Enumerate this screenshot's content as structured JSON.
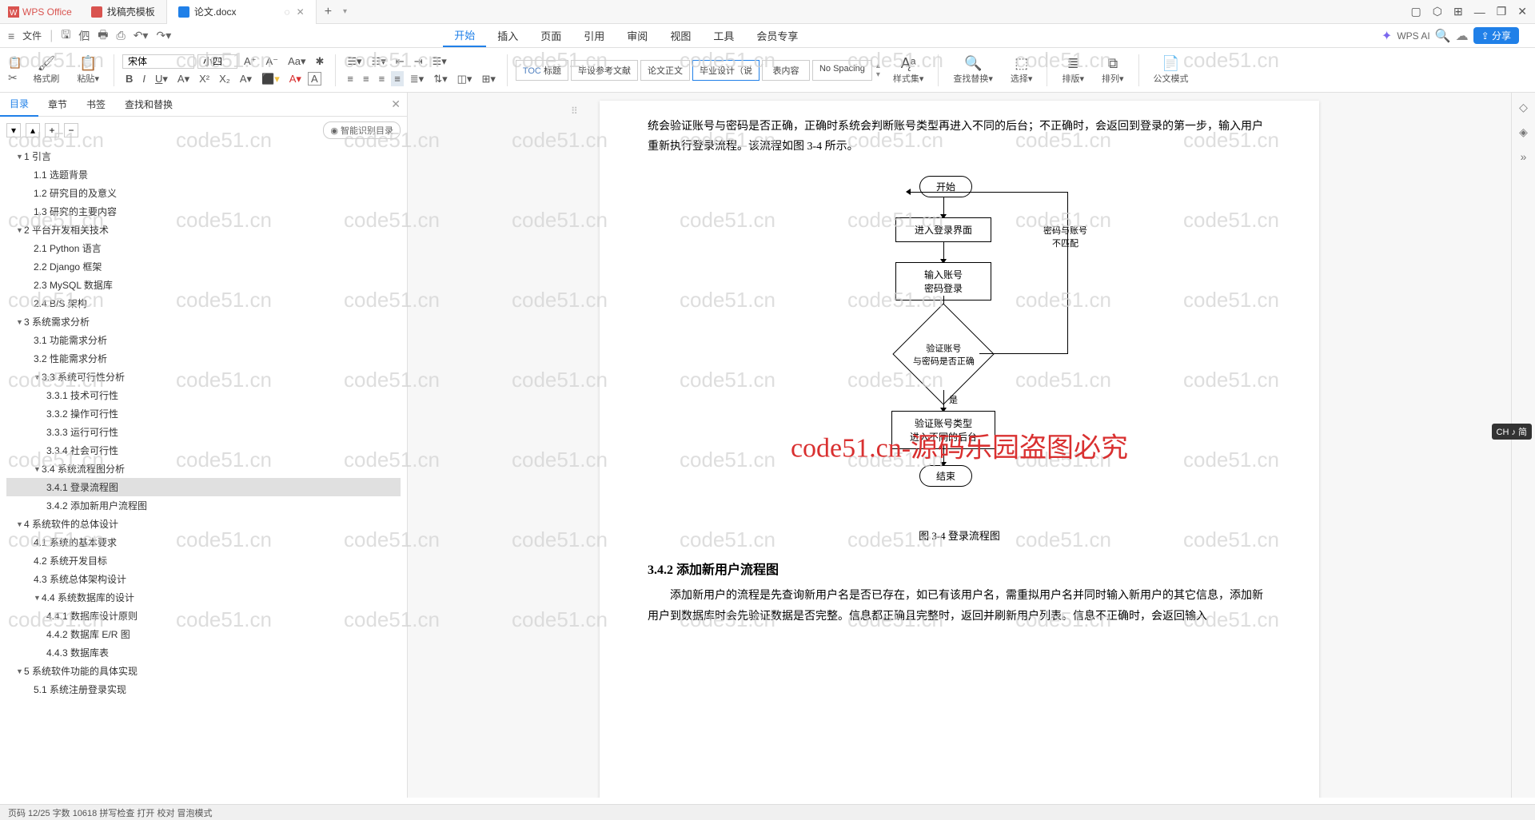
{
  "app": {
    "name": "WPS Office"
  },
  "tabs": [
    {
      "label": "找稿壳模板",
      "icon_color": "#d9534f"
    },
    {
      "label": "论文.docx",
      "icon_color": "#2080e8",
      "active": true
    }
  ],
  "toolbar": {
    "file": "文件"
  },
  "menu": {
    "items": [
      "开始",
      "插入",
      "页面",
      "引用",
      "审阅",
      "视图",
      "工具",
      "会员专享"
    ],
    "active": "开始",
    "wps_ai": "WPS AI",
    "share": "分享"
  },
  "ribbon": {
    "format_brush": "格式刷",
    "paste": "粘贴",
    "font_name": "宋体",
    "font_size": "小四",
    "styles": [
      "TOC 标题",
      "毕设参考文献",
      "论文正文",
      "毕业设计（说",
      "表内容",
      "No Spacing"
    ],
    "style_set": "样式集",
    "find_replace": "查找替换",
    "select": "选择",
    "sort": "排版",
    "arrange": "排列",
    "official": "公文模式"
  },
  "sidebar": {
    "tabs": [
      "目录",
      "章节",
      "书签",
      "查找和替换"
    ],
    "active_tab": "目录",
    "smart_toc": "智能识别目录",
    "toc": [
      {
        "level": 1,
        "label": "1 引言",
        "arrow": true
      },
      {
        "level": 2,
        "label": "1.1 选题背景"
      },
      {
        "level": 2,
        "label": "1.2 研究目的及意义"
      },
      {
        "level": 2,
        "label": "1.3 研究的主要内容"
      },
      {
        "level": 1,
        "label": "2 平台开发相关技术",
        "arrow": true
      },
      {
        "level": 2,
        "label": "2.1 Python 语言"
      },
      {
        "level": 2,
        "label": "2.2 Django 框架"
      },
      {
        "level": 2,
        "label": "2.3 MySQL 数据库"
      },
      {
        "level": 2,
        "label": "2.4 B/S 架构"
      },
      {
        "level": 1,
        "label": "3 系统需求分析",
        "arrow": true
      },
      {
        "level": 2,
        "label": "3.1 功能需求分析"
      },
      {
        "level": 2,
        "label": "3.2 性能需求分析"
      },
      {
        "level": 2,
        "label": "3.3 系统可行性分析",
        "arrow": true
      },
      {
        "level": 3,
        "label": "3.3.1 技术可行性"
      },
      {
        "level": 3,
        "label": "3.3.2 操作可行性"
      },
      {
        "level": 3,
        "label": "3.3.3 运行可行性"
      },
      {
        "level": 3,
        "label": "3.3.4 社会可行性"
      },
      {
        "level": 2,
        "label": "3.4 系统流程图分析",
        "arrow": true
      },
      {
        "level": 3,
        "label": "3.4.1 登录流程图",
        "selected": true
      },
      {
        "level": 3,
        "label": "3.4.2 添加新用户流程图"
      },
      {
        "level": 1,
        "label": "4 系统软件的总体设计",
        "arrow": true
      },
      {
        "level": 2,
        "label": "4.1 系统的基本要求"
      },
      {
        "level": 2,
        "label": "4.2 系统开发目标"
      },
      {
        "level": 2,
        "label": "4.3 系统总体架构设计"
      },
      {
        "level": 2,
        "label": "4.4 系统数据库的设计",
        "arrow": true
      },
      {
        "level": 3,
        "label": "4.4.1 数据库设计原则"
      },
      {
        "level": 3,
        "label": "4.4.2 数据库 E/R 图"
      },
      {
        "level": 3,
        "label": "4.4.3 数据库表"
      },
      {
        "level": 1,
        "label": "5 系统软件功能的具体实现",
        "arrow": true
      },
      {
        "level": 2,
        "label": "5.1 系统注册登录实现"
      }
    ]
  },
  "document": {
    "para1": "统会验证账号与密码是否正确，正确时系统会判断账号类型再进入不同的后台；不正确时，会返回到登录的第一步，输入用户重新执行登录流程。该流程如图 3-4 所示。",
    "flowchart": {
      "start": "开始",
      "step1": "进入登录界面",
      "step2a": "输入账号",
      "step2b": "密码登录",
      "decision_a": "验证账号",
      "decision_b": "与密码是否正确",
      "false_label_a": "密码与账号",
      "false_label_b": "不匹配",
      "yes_label": "是",
      "step3a": "验证账号类型",
      "step3b": "进入不同的后台",
      "end": "结束"
    },
    "fig_caption": "图 3-4 登录流程图",
    "heading": "3.4.2  添加新用户流程图",
    "para2": "添加新用户的流程是先查询新用户名是否已存在，如已有该用户名，需重拟用户名并同时输入新用户的其它信息，添加新用户到数据库时会先验证数据是否完整。信息都正确且完整时，返回并刷新用户列表。信息不正确时，会返回输入"
  },
  "watermark": "code51.cn",
  "center_watermark": "code51.cn-源码乐园盗图必究",
  "lang_badge": "CH ♪ 简",
  "statusbar": "页码 12/25  字数 10618  拼写检查 打开  校对  冒泡模式"
}
